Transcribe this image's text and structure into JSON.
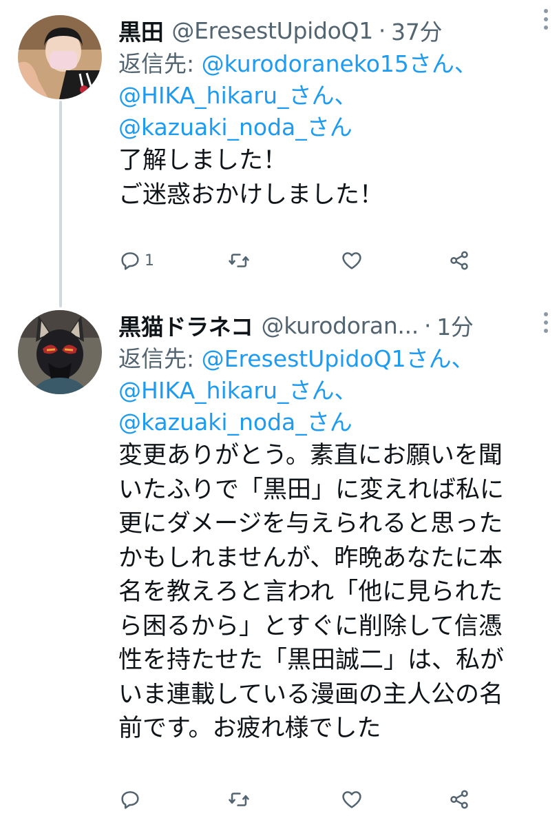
{
  "tweets": [
    {
      "display_name": "黒田",
      "handle": "@EresestUpidoQ1",
      "separator": "·",
      "time": "37分",
      "reply_label": "返信先: ",
      "reply_to_lines": [
        "@kurodoraneko15さん、",
        "@HIKA_hikaru_さん、",
        "@kazuaki_noda_さん"
      ],
      "body_lines": [
        "了解しました！",
        "ご迷惑おかけしました！"
      ],
      "reply_count": "1",
      "retweet_count": "",
      "like_count": ""
    },
    {
      "display_name": "黒猫ドラネコ",
      "handle": "@kurodoran...",
      "separator": "·",
      "time": "1分",
      "reply_label": "返信先: ",
      "reply_to_lines": [
        "@EresestUpidoQ1さん、",
        "@HIKA_hikaru_さん、",
        "@kazuaki_noda_さん"
      ],
      "body_lines": [
        "変更ありがとう。素直にお願いを聞",
        "いたふりで「黒田」に変えれば私に",
        "更にダメージを与えられると思った",
        "かもしれませんが、昨晩あなたに本",
        "名を教えろと言われ「他に見られた",
        "ら困るから」とすぐに削除して信憑",
        "性を持たせた「黒田誠二」は、私が",
        "いま連載している漫画の主人公の名",
        "前です。お疲れ様でした"
      ],
      "reply_count": "",
      "retweet_count": "",
      "like_count": ""
    }
  ],
  "icons": {
    "reply": "speech-bubble-icon",
    "retweet": "retweet-arrows-icon",
    "like": "heart-icon",
    "share": "share-nodes-icon",
    "more": "vertical-dots-icon"
  },
  "colors": {
    "text": "#0f1419",
    "secondary": "#536471",
    "link": "#1d9bf0",
    "thread_line": "#cfd9de",
    "icon": "#536471"
  }
}
